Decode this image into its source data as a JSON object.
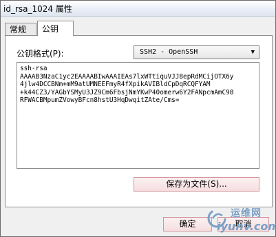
{
  "window": {
    "title": "id_rsa_1024 属性"
  },
  "tabs": [
    {
      "label": "常规",
      "selected": false
    },
    {
      "label": "公钥",
      "selected": true
    }
  ],
  "public_key_panel": {
    "format_label": "公钥格式(P):",
    "format_value": "SSH2 - OpenSSH",
    "key_text": "ssh-rsa\nAAAAB3NzaC1yc2EAAAABIwAAAIEAs7lxWTtiquVJJ8epRdMCijOTX6y\n4jlw4DCCBNm+mM9atUMNEEFmyR4fXpikAVIBldCpDqRCQFYAM\n+k44CZ3/YAGbYSMyU3JZ9Cm6FbsjNmYKwP40omerw6Y2FANpcmAmC98\nRFWACBMpumZVowyBFcn8hstU3HqDwqitZAte/Cms=",
    "save_as_label": "保存为文件(S)..."
  },
  "buttons": {
    "ok_label": "确定",
    "cancel_label": "取消"
  },
  "watermark": {
    "cn_text": "运维网",
    "en_text": "iyunv.com"
  },
  "colors": {
    "button_border": "#d1959a",
    "watermark": "#7aa0c6"
  }
}
